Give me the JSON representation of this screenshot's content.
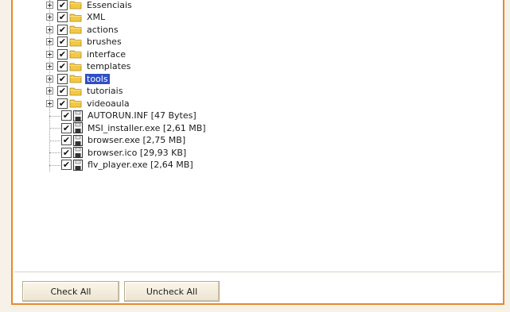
{
  "tree": {
    "folders": [
      {
        "label": "Essenciais",
        "selected": false
      },
      {
        "label": "XML",
        "selected": false
      },
      {
        "label": "actions",
        "selected": false
      },
      {
        "label": "brushes",
        "selected": false
      },
      {
        "label": "interface",
        "selected": false
      },
      {
        "label": "templates",
        "selected": false
      },
      {
        "label": "tools",
        "selected": true
      },
      {
        "label": "tutoriais",
        "selected": false
      },
      {
        "label": "videoaula",
        "selected": false
      }
    ],
    "files": [
      {
        "label": "AUTORUN.INF  [47 Bytes]"
      },
      {
        "label": "MSI_installer.exe  [2,61 MB]"
      },
      {
        "label": "browser.exe  [2,75 MB]"
      },
      {
        "label": "browser.ico  [29,93 KB]"
      },
      {
        "label": "flv_player.exe  [2,64 MB]"
      }
    ],
    "checked": true,
    "colors": {
      "selection": "#2f4fc6",
      "folder": "#f3c842",
      "border": "#e58a2e"
    }
  },
  "buttons": {
    "check_all": "Check All",
    "uncheck_all": "Uncheck All"
  }
}
